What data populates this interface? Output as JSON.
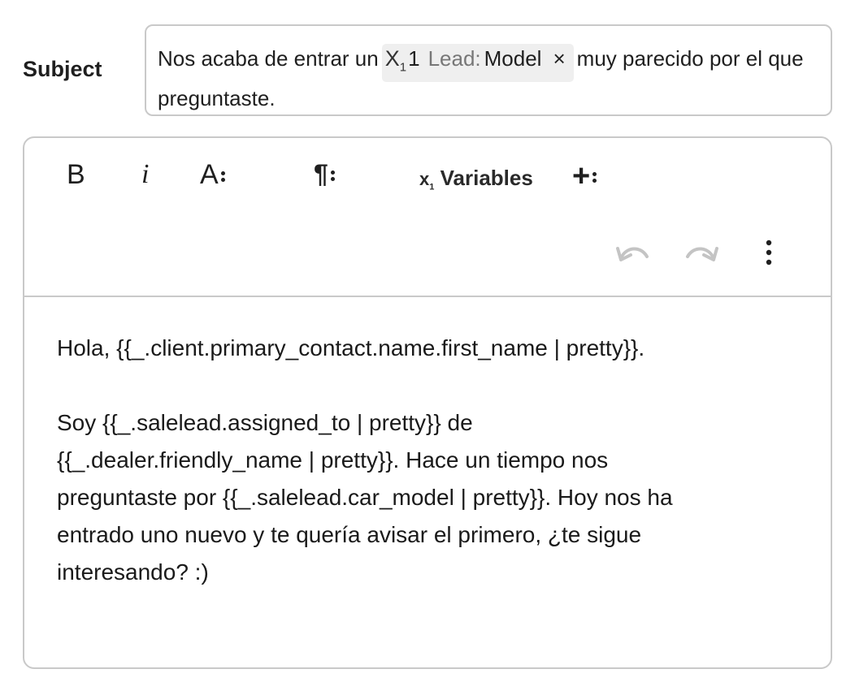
{
  "subject": {
    "label": "Subject",
    "text_before": "Nos acaba de entrar un",
    "chip": {
      "icon": "variable-x1-icon",
      "icon_text": "X",
      "icon_sub": "1",
      "count": "1",
      "source": "Lead:",
      "field": "Model",
      "close": "×"
    },
    "text_after": "muy parecido por el que preguntaste."
  },
  "toolbar": {
    "bold": "B",
    "italic": "i",
    "font": "A",
    "paragraph": "¶",
    "variables_icon_text": "x",
    "variables_icon_sub": "1",
    "variables_label": "Variables",
    "insert": "+"
  },
  "body": {
    "line1": "Hola, {{_.client.primary_contact.name.first_name | pretty}}.",
    "line2": "Soy {{_.salelead.assigned_to | pretty}} de",
    "line3": "{{_.dealer.friendly_name | pretty}}. Hace un tiempo nos",
    "line4": "preguntaste por {{_.salelead.car_model | pretty}}. Hoy nos ha",
    "line5": "entrado uno nuevo y te quería avisar el primero, ¿te sigue",
    "line6": "interesando? :)"
  },
  "colors": {
    "border": "#c9c9c9",
    "chip_bg": "#efefef",
    "icon_disabled": "#c4c4c4"
  }
}
